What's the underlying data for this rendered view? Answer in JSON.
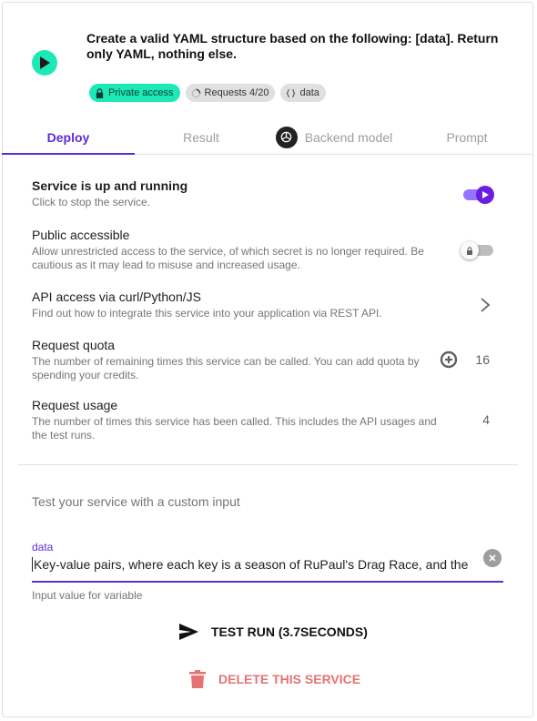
{
  "header": {
    "title": "Create a valid YAML structure based on the following: [data]. Return only YAML, nothing else.",
    "play_icon": "play-icon",
    "chips": [
      {
        "label": "Private access",
        "icon": "lock-icon"
      },
      {
        "label": "Requests 4/20",
        "icon": "progress-ring-icon"
      },
      {
        "label": "data",
        "icon": "braces-icon"
      }
    ]
  },
  "tabs": [
    {
      "label": "Deploy",
      "active": true
    },
    {
      "label": "Result",
      "active": false
    },
    {
      "label": "Backend model",
      "active": false,
      "icon": "openai-logo-icon"
    },
    {
      "label": "Prompt",
      "active": false
    }
  ],
  "settings": {
    "service": {
      "title": "Service is up and running",
      "desc": "Click to stop the service.",
      "toggle_on": true
    },
    "public": {
      "title": "Public accessible",
      "desc": "Allow unrestricted access to the service, of which secret is no longer required. Be cautious as it may lead to misuse and increased usage.",
      "toggle_on": false
    },
    "api": {
      "title": "API access via curl/Python/JS",
      "desc": "Find out how to integrate this service into your application via REST API."
    },
    "quota": {
      "title": "Request quota",
      "desc": "The number of remaining times this service can be called. You can add quota by spending your credits.",
      "value": "16"
    },
    "usage": {
      "title": "Request usage",
      "desc": "The number of times this service has been called. This includes the API usages and the test runs.",
      "value": "4"
    }
  },
  "test": {
    "heading": "Test your service with a custom input",
    "field_label": "data",
    "field_value": "Key-value pairs, where each key is a season of RuPaul's Drag Race, and the c",
    "helper": "Input value for variable",
    "run_label": "TEST RUN (3.7SECONDS)",
    "delete_label": "DELETE THIS SERVICE"
  },
  "colors": {
    "accent": "#5b2bd9",
    "teal": "#1de9b6",
    "danger": "#e57373"
  }
}
